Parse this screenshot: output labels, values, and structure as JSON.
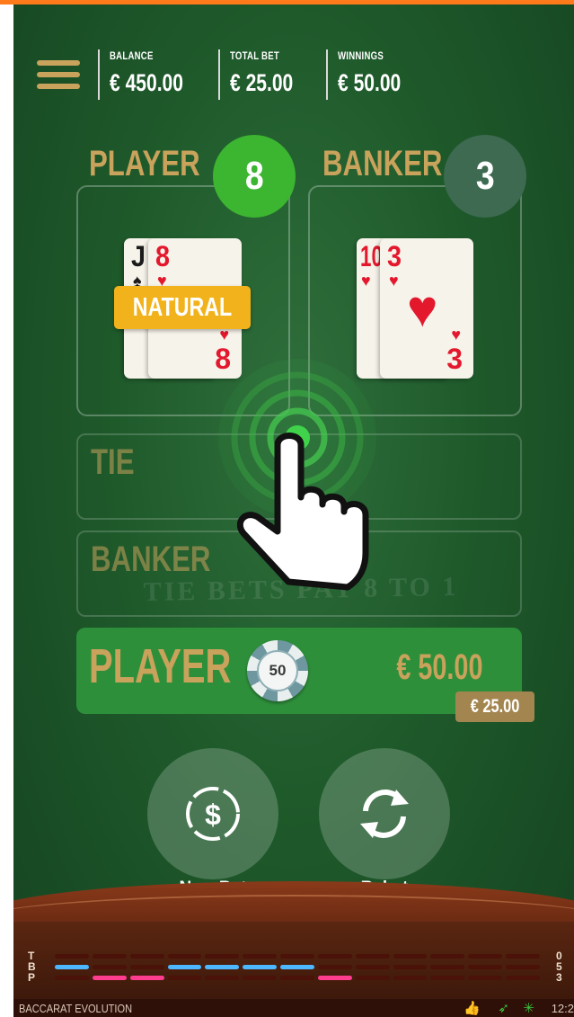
{
  "header": {
    "balance_label": "BALANCE",
    "balance": "€ 450.00",
    "total_bet_label": "TOTAL BET",
    "total_bet": "€ 25.00",
    "winnings_label": "WINNINGS",
    "winnings": "€ 50.00"
  },
  "player_hand": {
    "title": "PLAYER",
    "score": "8",
    "cards": [
      {
        "rank": "J",
        "suit": "♠",
        "color": "#1b1b1b"
      },
      {
        "rank": "8",
        "suit": "♥",
        "color": "#e3182d"
      }
    ],
    "badge": "NATURAL"
  },
  "banker_hand": {
    "title": "BANKER",
    "score": "3",
    "cards": [
      {
        "rank": "10",
        "suit": "♥",
        "color": "#e3182d"
      },
      {
        "rank": "3",
        "suit": "♥",
        "color": "#e3182d"
      }
    ]
  },
  "bets": {
    "tie": "TIE",
    "banker": "BANKER",
    "player": "PLAYER",
    "table_text": "TIE BETS PAY 8 TO 1",
    "player_amount": "€ 50.00",
    "chip_value": "50",
    "stake": "€ 25.00"
  },
  "actions": {
    "new_bet": "New Bet",
    "rebet": "Rebet"
  },
  "roadmap": {
    "labels": [
      "T",
      "B",
      "P"
    ],
    "counts": [
      "0",
      "5",
      "3"
    ]
  },
  "footer": {
    "brand": "BACCARAT EVOLUTION",
    "time": "12:2"
  },
  "colors": {
    "felt": "#1f5a2b",
    "gold": "#c9a25c",
    "player_score": "#3cb531",
    "banker_score": "#3d6a50",
    "banker_road": "#4db7ff",
    "player_road": "#ff3d8e",
    "accent": "#ff7a1a"
  }
}
